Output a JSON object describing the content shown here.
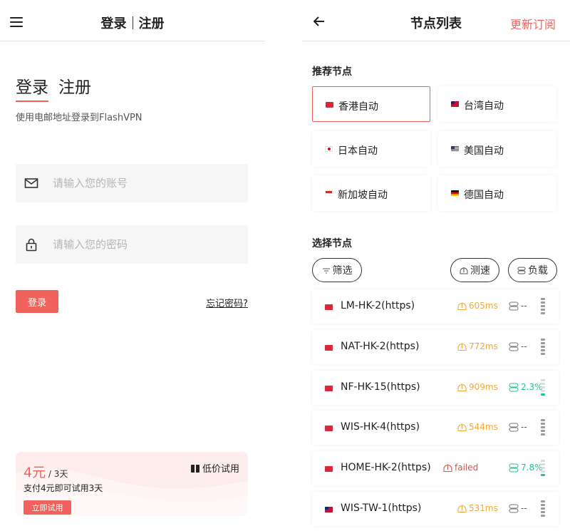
{
  "login": {
    "header": {
      "login": "登录",
      "register": "注册"
    },
    "tabs": {
      "login": "登录",
      "register": "注册"
    },
    "subtitle": "使用电邮地址登录到FlashVPN",
    "account_placeholder": "请输入您的账号",
    "password_placeholder": "请输入您的密码",
    "login_button": "登录",
    "forgot_password": "忘记密码?",
    "trial": {
      "price": "4元",
      "period": " / 3天",
      "description": "支付4元即可试用3天",
      "button": "立即试用",
      "gift_label": "低价试用"
    },
    "icons": {
      "menu": "menu-icon",
      "account": "envelope-icon",
      "password": "lock-icon",
      "gift": "gift-icon"
    }
  },
  "nodes": {
    "title": "节点列表",
    "update": "更新订阅",
    "recommended_title": "推荐节点",
    "recommended": [
      {
        "flag": "hk",
        "name": "香港自动",
        "selected": true
      },
      {
        "flag": "tw",
        "name": "台湾自动",
        "selected": false
      },
      {
        "flag": "jp",
        "name": "日本自动",
        "selected": false
      },
      {
        "flag": "us",
        "name": "美国自动",
        "selected": false
      },
      {
        "flag": "sg",
        "name": "新加坡自动",
        "selected": false
      },
      {
        "flag": "de",
        "name": "德国自动",
        "selected": false
      }
    ],
    "select_title": "选择节点",
    "filter": "筛选",
    "speed_test": "测速",
    "load": "负载",
    "list": [
      {
        "flag": "hk",
        "name": "LM-HK-2(https)",
        "speed": "605ms",
        "speed_status": "ok",
        "load": "--",
        "signal": 5
      },
      {
        "flag": "hk",
        "name": "NAT-HK-2(https)",
        "speed": "772ms",
        "speed_status": "ok",
        "load": "--",
        "signal": 5
      },
      {
        "flag": "hk",
        "name": "NF-HK-15(https)",
        "speed": "909ms",
        "speed_status": "ok",
        "load": "2.3%",
        "signal": 1
      },
      {
        "flag": "hk",
        "name": "WIS-HK-4(https)",
        "speed": "544ms",
        "speed_status": "ok",
        "load": "--",
        "signal": 5
      },
      {
        "flag": "hk",
        "name": "HOME-HK-2(https)",
        "speed": "failed",
        "speed_status": "failed",
        "load": "7.8%",
        "signal": 1
      },
      {
        "flag": "tw",
        "name": "WIS-TW-1(https)",
        "speed": "531ms",
        "speed_status": "ok",
        "load": "--",
        "signal": 5
      }
    ],
    "colors": {
      "accent": "#f0625b",
      "speed_ok": "#f0a93a",
      "speed_failed": "#e0524a",
      "load_ok": "#23c38c"
    }
  }
}
